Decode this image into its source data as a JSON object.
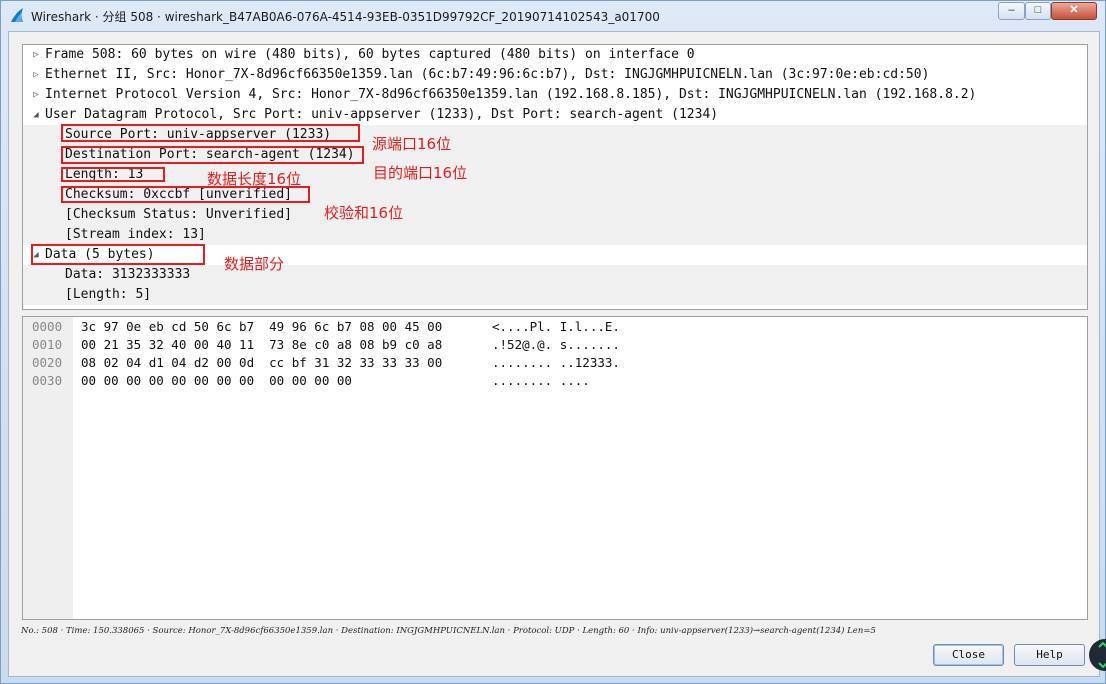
{
  "window": {
    "title": "Wireshark · 分组 508 · wireshark_B47AB0A6-076A-4514-93EB-0351D99792CF_20190714102543_a01700",
    "controls": {
      "minimize": "‒",
      "maximize": "□",
      "close": "✕"
    }
  },
  "tree": {
    "items": [
      {
        "label": "Frame 508: 60 bytes on wire (480 bits), 60 bytes captured (480 bits) on interface 0",
        "state": "collapsed"
      },
      {
        "label": "Ethernet II, Src: Honor_7X-8d96cf66350e1359.lan (6c:b7:49:96:6c:b7), Dst: INGJGMHPUICNELN.lan (3c:97:0e:eb:cd:50)",
        "state": "collapsed"
      },
      {
        "label": "Internet Protocol Version 4, Src: Honor_7X-8d96cf66350e1359.lan (192.168.8.185), Dst: INGJGMHPUICNELN.lan (192.168.8.2)",
        "state": "collapsed"
      },
      {
        "label": "User Datagram Protocol, Src Port: univ-appserver (1233), Dst Port: search-agent (1234)",
        "state": "expanded"
      },
      {
        "label": "Source Port: univ-appserver (1233)",
        "state": "leaf"
      },
      {
        "label": "Destination Port: search-agent (1234)",
        "state": "leaf"
      },
      {
        "label": "Length: 13",
        "state": "leaf"
      },
      {
        "label": "Checksum: 0xccbf [unverified]",
        "state": "leaf"
      },
      {
        "label": "[Checksum Status: Unverified]",
        "state": "leaf"
      },
      {
        "label": "[Stream index: 13]",
        "state": "leaf"
      },
      {
        "label": "Data (5 bytes)",
        "state": "expanded"
      },
      {
        "label": "Data: 3132333333",
        "state": "leaf"
      },
      {
        "label": "[Length: 5]",
        "state": "leaf"
      }
    ]
  },
  "hex": {
    "rows": [
      {
        "offset": "0000",
        "bytes": "3c 97 0e eb cd 50 6c b7  49 96 6c b7 08 00 45 00",
        "ascii": "<....Pl. I.l...E."
      },
      {
        "offset": "0010",
        "bytes": "00 21 35 32 40 00 40 11  73 8e c0 a8 08 b9 c0 a8",
        "ascii": ".!52@.@. s......."
      },
      {
        "offset": "0020",
        "bytes": "08 02 04 d1 04 d2 00 0d  cc bf 31 32 33 33 33 00",
        "ascii": "........ ..12333."
      },
      {
        "offset": "0030",
        "bytes": "00 00 00 00 00 00 00 00  00 00 00 00",
        "ascii": "........ ...."
      }
    ]
  },
  "status": {
    "text": "No.: 508 · Time: 150.338065 · Source: Honor_7X-8d96cf66350e1359.lan · Destination: INGJGMHPUICNELN.lan · Protocol: UDP · Length: 60 · Info: univ-appserver(1233)→search-agent(1234) Len=5"
  },
  "buttons": {
    "close": "Close",
    "help": "Help"
  },
  "annotations": {
    "source_port": "源端口16位",
    "dest_port": "目的端口16位",
    "length": "数据长度16位",
    "checksum": "校验和16位",
    "data": "数据部分",
    "color": "#e41f1f"
  }
}
